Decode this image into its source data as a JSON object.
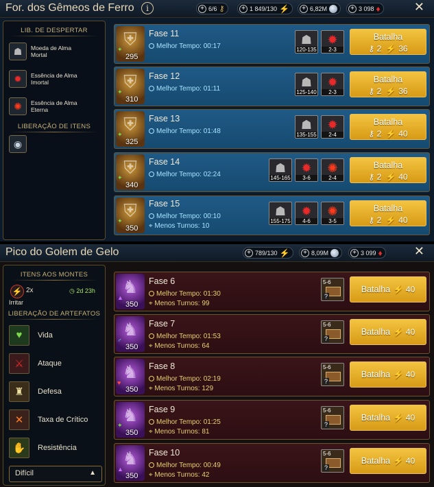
{
  "colors": {
    "accent_gold": "#f3c440",
    "panel1_row": "#1f5a86",
    "panel2_row": "#3a1418",
    "time_blue": "#a8e4ff",
    "time_gold": "#e8d070"
  },
  "panel1": {
    "title": "For. dos Gêmeos de Ferro",
    "info_icon": "i",
    "resources": {
      "keys": "6/6",
      "energy": "1 849/130",
      "silver": "6,82M",
      "gems": "3 098"
    },
    "close": "✕",
    "sidebar": {
      "heading_awakening": "LIB. DE DESPERTAR",
      "items": [
        {
          "icon": "mortal-soul-coin-icon",
          "label_l1": "Moeda de Alma",
          "label_l2": "Mortal"
        },
        {
          "icon": "immortal-soul-essence-icon",
          "label_l1": "Essência de Alma",
          "label_l2": "Imortal"
        },
        {
          "icon": "eternal-soul-essence-icon",
          "label_l1": "Essência de Alma",
          "label_l2": "Eterna"
        }
      ],
      "heading_items": "LIBERAÇÃO DE ITENS"
    },
    "stages": [
      {
        "name": "Fase 11",
        "level": "295",
        "time_label": "Melhor Tempo: 00:17",
        "turns_label": "",
        "drops": [
          "120-135",
          "2-3"
        ],
        "battle_label": "Batalha",
        "keys": "2",
        "energy": "36"
      },
      {
        "name": "Fase 12",
        "level": "310",
        "time_label": "Melhor Tempo: 01:11",
        "turns_label": "",
        "drops": [
          "125-140",
          "2-3"
        ],
        "battle_label": "Batalha",
        "keys": "2",
        "energy": "36"
      },
      {
        "name": "Fase 13",
        "level": "325",
        "time_label": "Melhor Tempo: 01:48",
        "turns_label": "",
        "drops": [
          "135-155",
          "2-4"
        ],
        "battle_label": "Batalha",
        "keys": "2",
        "energy": "40"
      },
      {
        "name": "Fase 14",
        "level": "340",
        "time_label": "Melhor Tempo: 02:24",
        "turns_label": "",
        "drops": [
          "145-165",
          "3-6",
          "2-4"
        ],
        "battle_label": "Batalha",
        "keys": "2",
        "energy": "40"
      },
      {
        "name": "Fase 15",
        "level": "350",
        "time_label": "Melhor Tempo: 00:10",
        "turns_label": "Menos Turnos: 10",
        "drops": [
          "155-175",
          "4-6",
          "3-5"
        ],
        "battle_label": "Batalha",
        "keys": "2",
        "energy": "40"
      }
    ]
  },
  "panel2": {
    "title": "Pico do Golem de Gelo",
    "resources": {
      "energy": "789/130",
      "silver": "8,09M",
      "gems": "3 099"
    },
    "close": "✕",
    "sidebar": {
      "heading_piles": "ITENS AOS MONTES",
      "buff_multiplier": "2x",
      "buff_timer": "2d 23h",
      "buff_name": "Irritar",
      "heading_artifacts": "LIBERAÇÃO DE ARTEFATOS",
      "artifacts": [
        {
          "label": "Vida",
          "icon": "heart-icon"
        },
        {
          "label": "Ataque",
          "icon": "sword-icon"
        },
        {
          "label": "Defesa",
          "icon": "tower-icon"
        },
        {
          "label": "Taxa de Crítico",
          "icon": "crossed-swords-icon"
        },
        {
          "label": "Resistência",
          "icon": "hand-icon"
        }
      ],
      "difficulty": "Difícil"
    },
    "stages": [
      {
        "name": "Fase 6",
        "level": "350",
        "time_label": "Melhor Tempo: 01:30",
        "turns_label": "Menos Turnos: 99",
        "chest_rank": "5-6",
        "battle_label": "Batalha",
        "energy": "40"
      },
      {
        "name": "Fase 7",
        "level": "350",
        "time_label": "Melhor Tempo: 01:53",
        "turns_label": "Menos Turnos: 64",
        "chest_rank": "5-6",
        "battle_label": "Batalha",
        "energy": "40"
      },
      {
        "name": "Fase 8",
        "level": "350",
        "time_label": "Melhor Tempo: 02:19",
        "turns_label": "Menos Turnos: 129",
        "chest_rank": "5-6",
        "battle_label": "Batalha",
        "energy": "40"
      },
      {
        "name": "Fase 9",
        "level": "350",
        "time_label": "Melhor Tempo: 01:25",
        "turns_label": "Menos Turnos: 81",
        "chest_rank": "5-6",
        "battle_label": "Batalha",
        "energy": "40"
      },
      {
        "name": "Fase 10",
        "level": "350",
        "time_label": "Melhor Tempo: 00:49",
        "turns_label": "Menos Turnos: 42",
        "chest_rank": "5-6",
        "battle_label": "Batalha",
        "energy": "40"
      }
    ]
  }
}
